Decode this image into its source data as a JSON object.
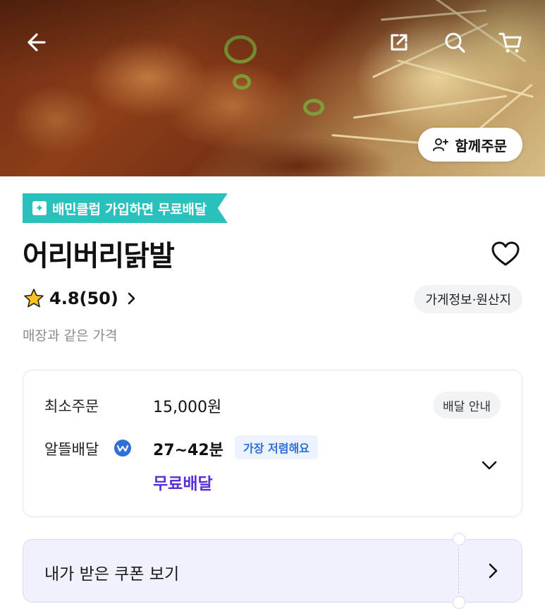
{
  "header": {
    "icons": [
      "back-arrow-icon",
      "share-icon",
      "search-icon",
      "cart-icon"
    ],
    "together_order_label": "함께주문"
  },
  "club_banner": {
    "text": "배민클럽 가입하면 무료배달",
    "color": "#2ac1bc"
  },
  "store": {
    "name": "어리버리닭발",
    "rating": "4.8",
    "review_count": "(50)",
    "info_label": "가게정보·원산지",
    "price_note": "매장과 같은 가격"
  },
  "delivery": {
    "min_order_label": "최소주문",
    "min_order_value": "15,000원",
    "guide_label": "배달 안내",
    "type_label": "알뜰배달",
    "time": "27~42분",
    "cheap_badge": "가장 저렴해요",
    "fee_label": "무료배달",
    "fee_color": "#5a2fd8"
  },
  "coupon": {
    "label": "내가 받은 쿠폰 보기"
  }
}
